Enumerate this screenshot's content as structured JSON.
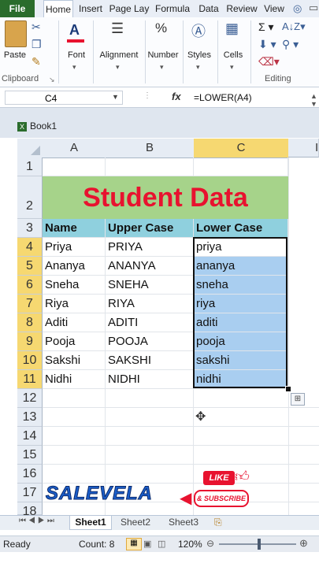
{
  "ribbon_tabs": [
    "File",
    "Home",
    "Insert",
    "Page Lay",
    "Formula",
    "Data",
    "Review",
    "View"
  ],
  "ribbon": {
    "paste": "Paste",
    "clipboard": "Clipboard",
    "font": "Font",
    "alignment": "Alignment",
    "number": "Number",
    "styles": "Styles",
    "cells": "Cells",
    "editing": "Editing"
  },
  "formula_bar": {
    "cell_ref": "C4",
    "fx": "fx",
    "formula": "=LOWER(A4)"
  },
  "workbook": {
    "title": "Book1"
  },
  "columns": [
    "A",
    "B",
    "C"
  ],
  "rows": [
    "1",
    "2",
    "3",
    "4",
    "5",
    "6",
    "7",
    "8",
    "9",
    "10",
    "11",
    "12",
    "13",
    "14",
    "15",
    "16",
    "17",
    "18"
  ],
  "sheet": {
    "title": "Student Data",
    "headers": [
      "Name",
      "Upper Case",
      "Lower Case"
    ],
    "data": [
      [
        "Priya",
        "PRIYA",
        "priya"
      ],
      [
        "Ananya",
        "ANANYA",
        "ananya"
      ],
      [
        "Sneha",
        "SNEHA",
        "sneha"
      ],
      [
        "Riya",
        "RIYA",
        "riya"
      ],
      [
        "Aditi",
        "ADITI",
        "aditi"
      ],
      [
        "Pooja",
        "POOJA",
        "pooja"
      ],
      [
        "Sakshi",
        "SAKSHI",
        "sakshi"
      ],
      [
        "Nidhi",
        "NIDHI",
        "nidhi"
      ]
    ]
  },
  "sheet_tabs": [
    "Sheet1",
    "Sheet2",
    "Sheet3"
  ],
  "status": {
    "mode": "Ready",
    "count": "Count: 8",
    "zoom": "120%"
  },
  "brand": {
    "logo": "SALEVELA",
    "like": "LIKE",
    "subscribe": "& SUBSCRIBE"
  },
  "colors": {
    "title_red": "#e8122f",
    "title_bg": "#a6d38a",
    "header_bg": "#8fd0de",
    "selection": "#a9cef0",
    "file_tab": "#2a6c2c",
    "accent_yellow": "#f6d871"
  }
}
